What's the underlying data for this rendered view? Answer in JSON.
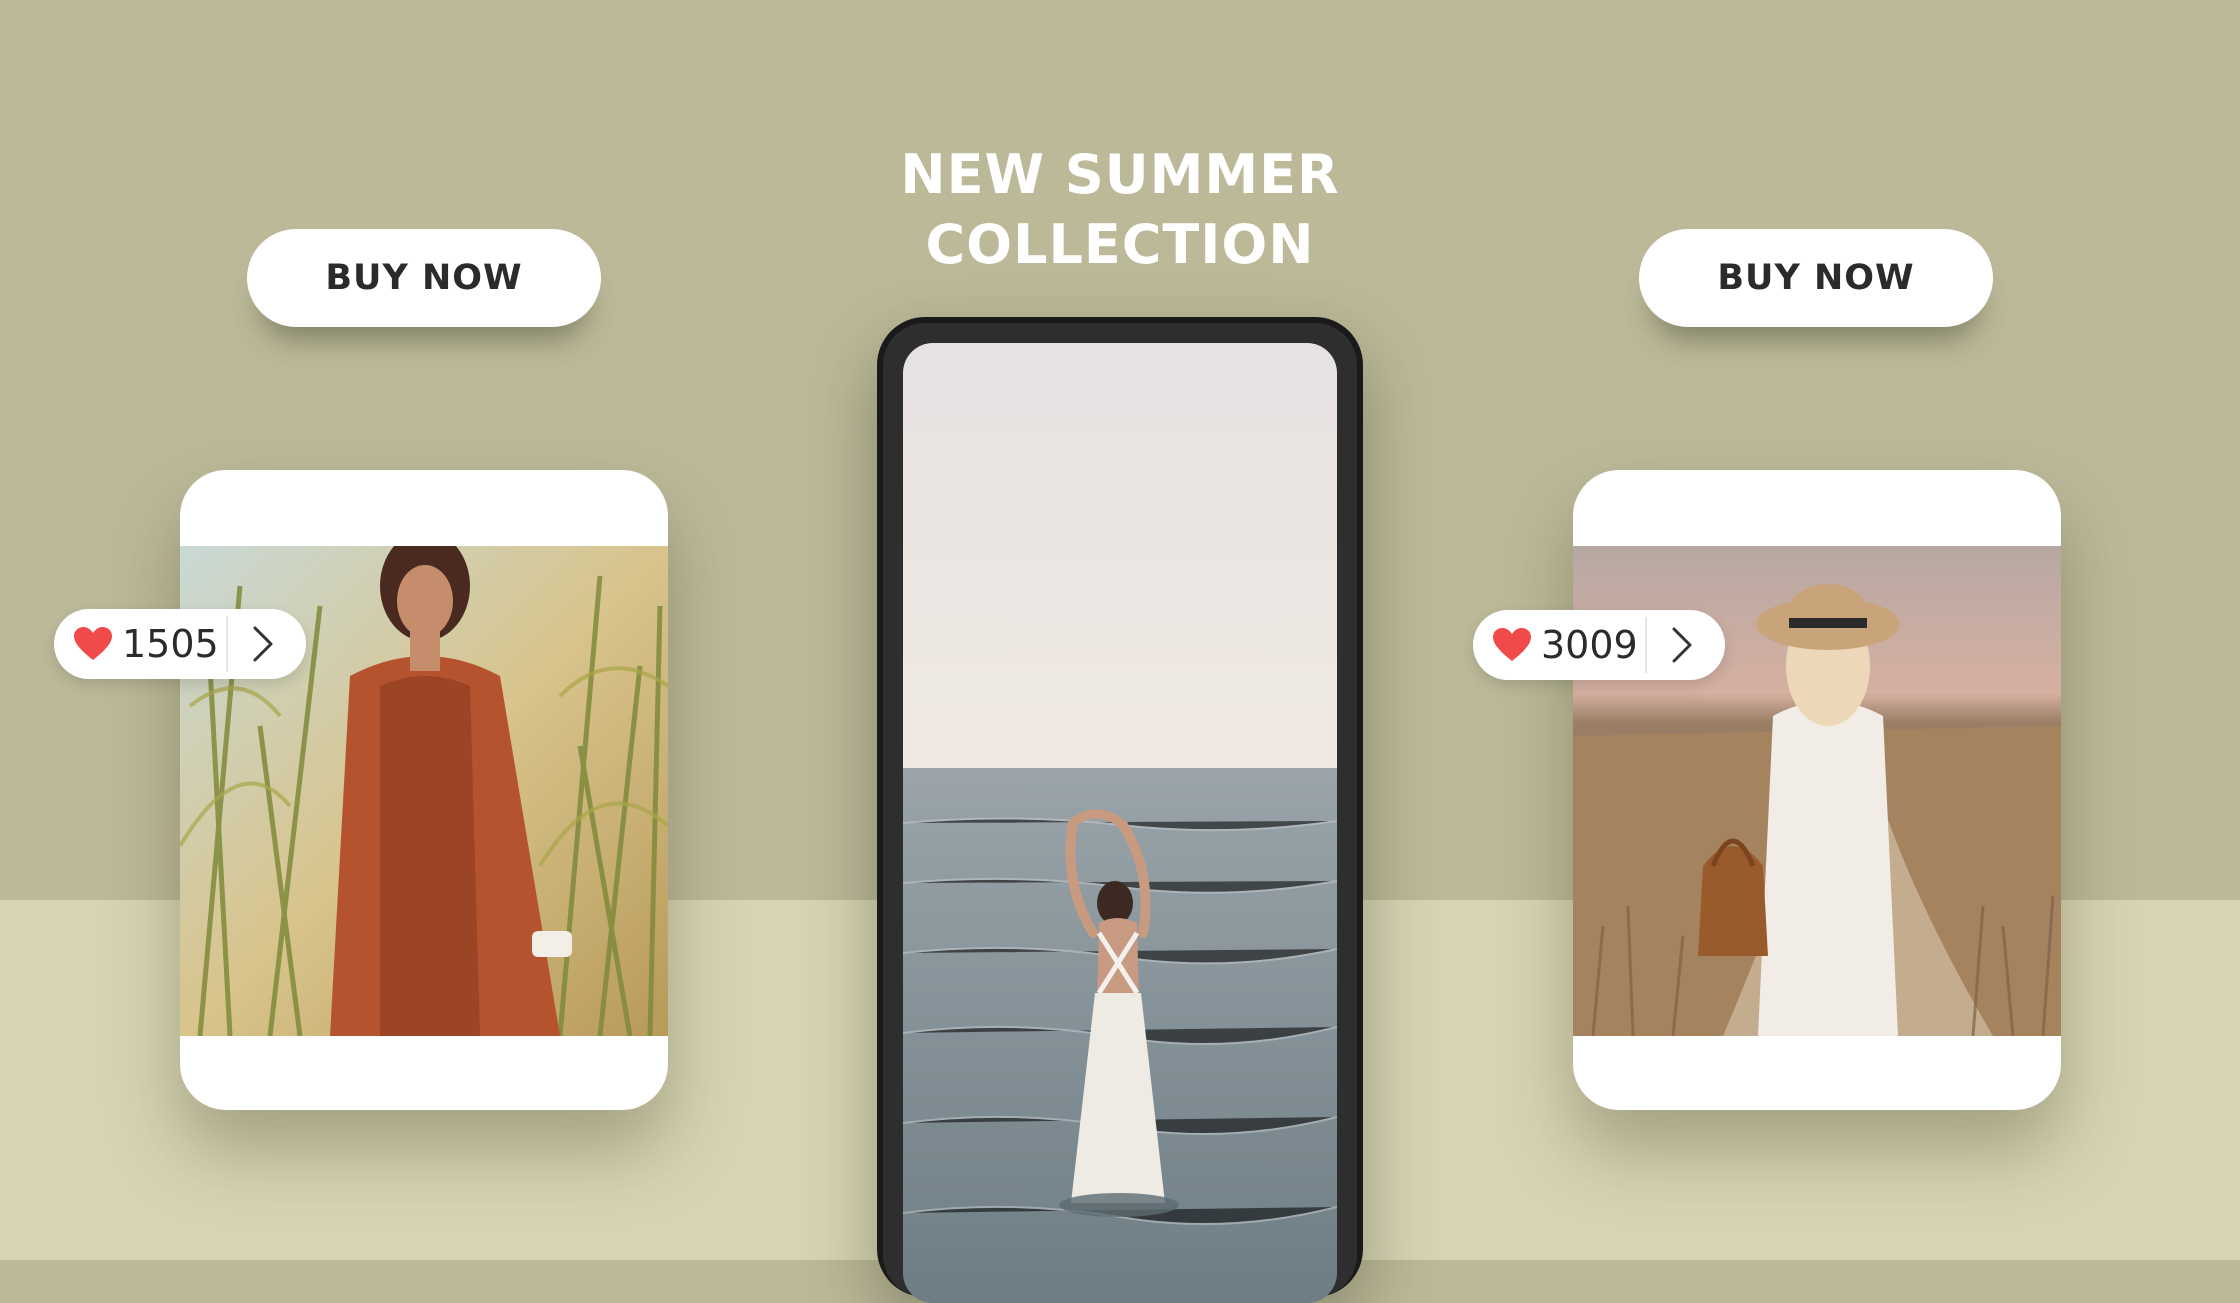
{
  "headline": {
    "line1": "NEW SUMMER",
    "line2": "COLLECTION"
  },
  "buttons": {
    "left_label": "BUY NOW",
    "right_label": "BUY NOW"
  },
  "likes": {
    "left_count": "1505",
    "right_count": "3009"
  },
  "icons": {
    "like": "heart-icon",
    "next": "chevron-right-icon"
  },
  "colors": {
    "background": "#bbb998",
    "floor": "#d6d4b3",
    "heart": "#f04a4a",
    "button_text": "#2b2b2b"
  }
}
